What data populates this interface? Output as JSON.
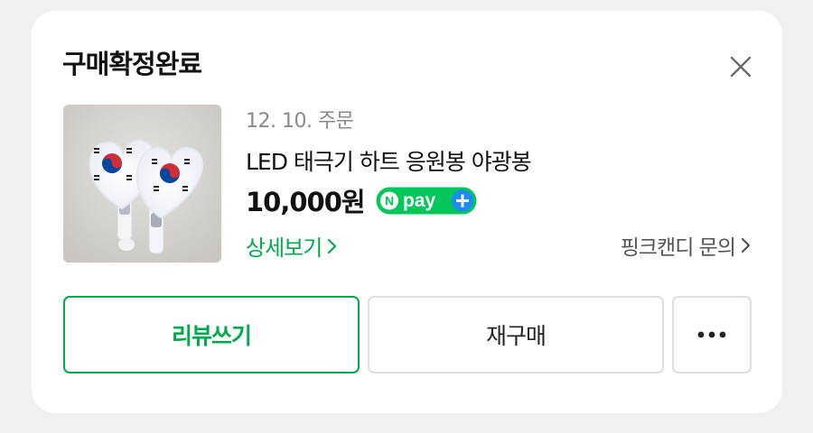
{
  "card": {
    "title": "구매확정완료",
    "close_icon": "close-icon"
  },
  "order": {
    "date": "12. 10. 주문",
    "product_name": "LED 태극기 하트 응원봉 야광봉",
    "price": "10,000원",
    "payment_badge": {
      "text": "pay",
      "icon": "npay-plus-icon",
      "color": "#03c75a"
    },
    "thumbnail_icon": "product-image",
    "detail_link": "상세보기",
    "inquiry_link": "핑크캔디 문의"
  },
  "actions": {
    "review_label": "리뷰쓰기",
    "rebuy_label": "재구매",
    "more_icon": "more-dots-icon"
  },
  "colors": {
    "accent": "#03a94d",
    "background": "#eef0f2",
    "card": "#ffffff",
    "border": "#dcdfe3"
  }
}
